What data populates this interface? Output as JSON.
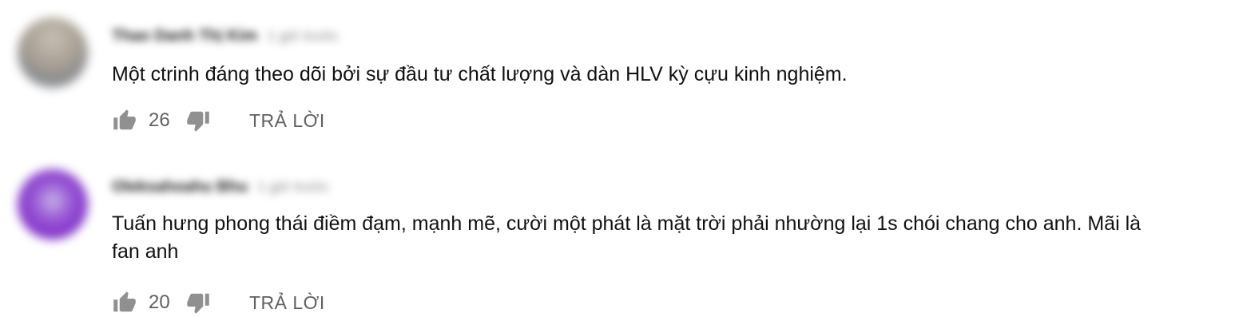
{
  "comments": [
    {
      "author": "Thao Danh Thị Kim",
      "timestamp": "1 giờ trước",
      "text": "Một ctrinh đáng theo dõi bởi sự đầu tư chất lượng và dàn HLV kỳ cựu kinh nghiệm.",
      "likes": "26",
      "reply_label": "TRẢ LỜI",
      "icons": {
        "like": "thumb-up-icon",
        "dislike": "thumb-down-icon"
      }
    },
    {
      "author": "Oleksahoahu Bhu",
      "timestamp": "1 giờ trước",
      "text": "Tuấn hưng phong thái điềm đạm, mạnh mẽ, cười một phát là mặt trời phải nhường lại 1s chói chang cho anh. Mãi là fan anh",
      "likes": "20",
      "reply_label": "TRẢ LỜI",
      "icons": {
        "like": "thumb-up-icon",
        "dislike": "thumb-down-icon"
      }
    }
  ],
  "colors": {
    "text": "#111111",
    "secondary": "#606060",
    "icon": "#909090",
    "avatar_1": "#a7a39c",
    "avatar_2": "#8436c9"
  }
}
